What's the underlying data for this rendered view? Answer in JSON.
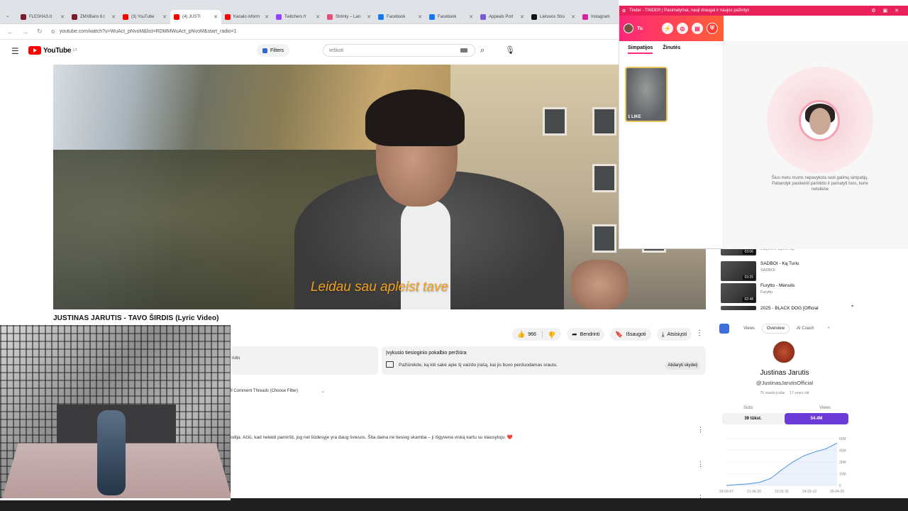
{
  "browser": {
    "tabs": [
      {
        "label": "FLESHAS.lt",
        "color": "#7b1b2e"
      },
      {
        "label": "ZMXBans 6.t",
        "color": "#7b1b2e"
      },
      {
        "label": "(3) YouTube",
        "color": "#ff0000"
      },
      {
        "label": "(4) JUSTI",
        "color": "#ff0000"
      },
      {
        "label": "Kanalo inform",
        "color": "#ff0000"
      },
      {
        "label": "Twitchers fr",
        "color": "#9146ff"
      },
      {
        "label": "Strimly – Lan",
        "color": "#e94e77"
      },
      {
        "label": "Facebook",
        "color": "#1877f2"
      },
      {
        "label": "Facebook",
        "color": "#1877f2"
      },
      {
        "label": "Appeals Port",
        "color": "#7a5ad6"
      },
      {
        "label": "Lietuvos Stru",
        "color": "#111111"
      },
      {
        "label": "Instagram",
        "color": "#d6249f"
      }
    ],
    "url": "youtube.com/watch?v=WuAct_pNvoM&list=RDMMWuAct_pNvoM&start_radio=1"
  },
  "youtube": {
    "logo_text": "YouTube",
    "logo_sup": "LT",
    "filters_label": "Filters",
    "search_placeholder": "Ieškoti",
    "subtitle": "Leidau sau apleist tave",
    "video_title": "JUSTINAS JARUTIS - TAVO ŠIRDIS (Lyric Video)",
    "actions": {
      "like_count": "966",
      "share": "Bendrinti",
      "save": "Išsaugoti",
      "download": "Atsisiųsti"
    },
    "live_left_fragment": "rutis",
    "live_card": {
      "title": "Įvykusio tiesioginio pokalbio peržiūra",
      "desc": "Pažiūrėkite, ką kiti sakė apie šį vaizdo įrašą, kai jis buvo perduodamas srautu.",
      "button": "Atidaryti skydelį"
    },
    "threads_label": "ll Comment Threads (Choose Filter)",
    "comment_text": "odija. Ačiū, kad neleidi pamiršti, jog net liūdesyje yra daug šviesos. Šita daina ne tiesiog skamba – ji išgyvena viską kartu su klausytoju. ❤️"
  },
  "tinder": {
    "window_title": "Tinder - TINDER | Pasimatymai, nauji draugai ir naujos pažintys",
    "profile_label": "Tu",
    "tabs": [
      "Simpatijos",
      "Žinutės"
    ],
    "like_card_label": "1 LIKE",
    "empty_info": "Šiuo metu mums nepavyksta rasti galimų simpatijų. Pabandyk pasikeisti parinktis ir pamatyti tuos, kurie netoliese"
  },
  "related": [
    {
      "title": "",
      "channel": "Elzyork ir OpenPlay",
      "duration": "03:06"
    },
    {
      "title": "SADBOI - Ką Turiu",
      "channel": "SADBOI",
      "duration": "03:25"
    },
    {
      "title": "Furytto - Mėnulis",
      "channel": "Furytto",
      "duration": "02:48"
    },
    {
      "title": "2025 - BLACK DOG [Official",
      "channel": "",
      "duration": ""
    }
  ],
  "stats": {
    "tabs": [
      "Views",
      "Overview",
      "AI Coach"
    ],
    "active_tab": "Overview",
    "channel_name": "Justinas Jarutis",
    "handle": "@JustinasJarutisOfficial",
    "meta_left": "75 vaizdo įrašai",
    "meta_right": "17 years old",
    "subs_label": "Subs",
    "views_label": "Views",
    "subs_value": "39 tūkst.",
    "views_value": "54.4M",
    "accent": "#6a3bd6",
    "chart_data": {
      "type": "line",
      "x": [
        "19-09-07",
        "21-06-20",
        "23-01-31",
        "24-09-12",
        "26-04-25"
      ],
      "y_ticks": [
        "60M",
        "45M",
        "30M",
        "15M",
        "0"
      ],
      "ylim": [
        0,
        60
      ],
      "series": [
        {
          "values": [
            0,
            1,
            2,
            4,
            9,
            20,
            30,
            38,
            43,
            47,
            54.4
          ]
        }
      ]
    }
  }
}
